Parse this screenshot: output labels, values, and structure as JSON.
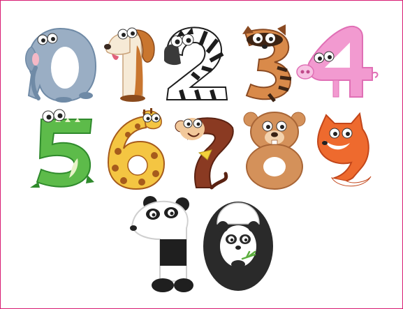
{
  "illustration": {
    "frame_color": "#d81b72",
    "rows": [
      [
        {
          "numeral": "0",
          "animal_icon": "elephant-icon",
          "colors": {
            "body": "#9aaec4",
            "shade": "#6f8aa6",
            "accent": "#f5b8c6"
          }
        },
        {
          "numeral": "1",
          "animal_icon": "dog-icon",
          "colors": {
            "body": "#f6ead6",
            "shade": "#c9762f",
            "accent": "#8a4a1c"
          }
        },
        {
          "numeral": "2",
          "animal_icon": "zebra-icon",
          "colors": {
            "body": "#ffffff",
            "shade": "#1d1d1d",
            "accent": "#3a3a3a"
          }
        },
        {
          "numeral": "3",
          "animal_icon": "raccoon-icon",
          "colors": {
            "body": "#d98a4a",
            "shade": "#8a4a22",
            "accent": "#3d2414"
          }
        },
        {
          "numeral": "4",
          "animal_icon": "pig-icon",
          "colors": {
            "body": "#f29ad0",
            "shade": "#e06fb5",
            "accent": "#f7c3e3"
          }
        }
      ],
      [
        {
          "numeral": "5",
          "animal_icon": "crocodile-icon",
          "colors": {
            "body": "#5dbb4a",
            "shade": "#2f8a2c",
            "accent": "#e8f3c8"
          }
        },
        {
          "numeral": "6",
          "animal_icon": "giraffe-icon",
          "colors": {
            "body": "#f4c542",
            "shade": "#a65b1c",
            "accent": "#7a3d12"
          }
        },
        {
          "numeral": "7",
          "animal_icon": "monkey-icon",
          "colors": {
            "body": "#8a3a22",
            "shade": "#5a2212",
            "accent": "#f2c89a"
          }
        },
        {
          "numeral": "8",
          "animal_icon": "bear-icon",
          "colors": {
            "body": "#d4915a",
            "shade": "#a86536",
            "accent": "#f3d2ad"
          }
        },
        {
          "numeral": "9",
          "animal_icon": "fox-icon",
          "colors": {
            "body": "#ee6a2e",
            "shade": "#c2461a",
            "accent": "#ffffff"
          }
        }
      ],
      [
        {
          "numeral": "1",
          "animal_icon": "panda-icon",
          "colors": {
            "body": "#ffffff",
            "shade": "#1f1f1f",
            "accent": "#cfcfcf"
          }
        },
        {
          "numeral": "0",
          "animal_icon": "panda-icon",
          "colors": {
            "body": "#ffffff",
            "shade": "#2a2a2a",
            "accent": "#5cae3e"
          }
        }
      ]
    ]
  }
}
